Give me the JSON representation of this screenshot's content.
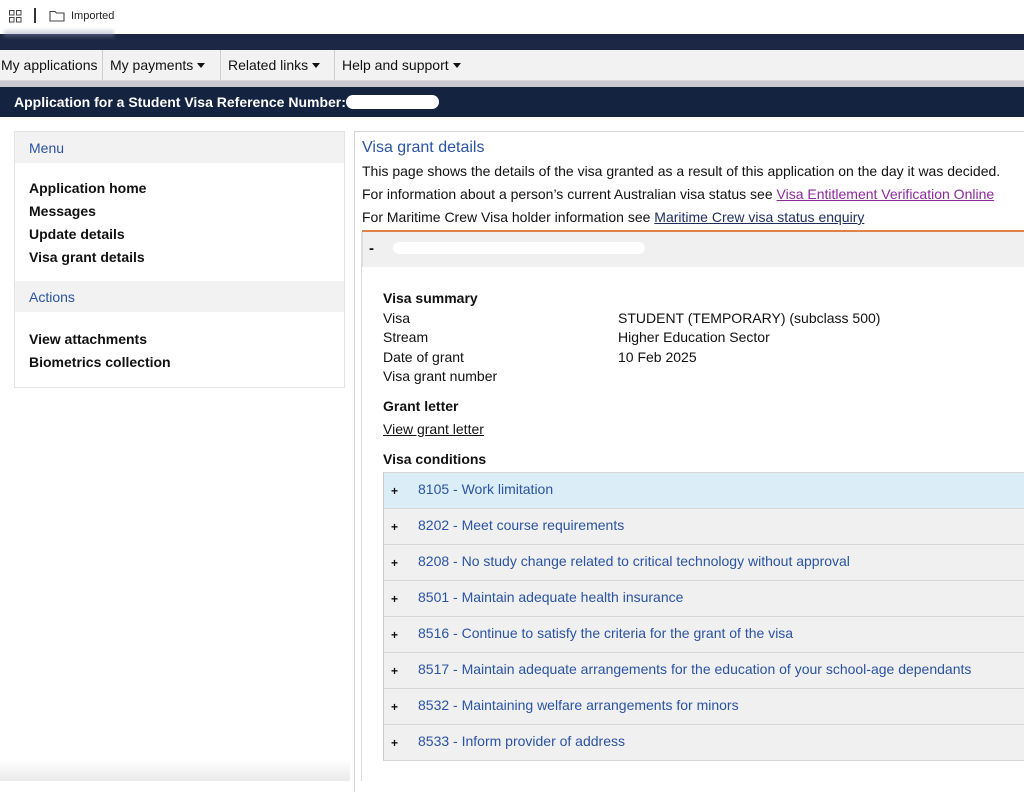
{
  "bookmarks": {
    "folder_label": "Imported"
  },
  "nav": {
    "items": [
      {
        "label": "My applications"
      },
      {
        "label": "My payments"
      },
      {
        "label": "Related links"
      },
      {
        "label": "Help and support"
      }
    ]
  },
  "title_bar": {
    "text": "Application for a Student Visa Reference Number:"
  },
  "sidebar": {
    "menu_heading": "Menu",
    "menu_items": [
      "Application home",
      "Messages",
      "Update details",
      "Visa grant details"
    ],
    "actions_heading": "Actions",
    "action_items": [
      "View attachments",
      "Biometrics collection"
    ]
  },
  "main": {
    "title": "Visa grant details",
    "intro": "This page shows the details of the visa granted as a result of this application on the day it was decided.",
    "info_prefix": "For information about a person’s current Australian visa status see ",
    "vevo_link": "Visa Entitlement Verification Online",
    "crew_prefix": "For Maritime Crew Visa holder information see ",
    "crew_link": "Maritime Crew visa status enquiry",
    "accordion_toggle": "-",
    "summary_heading": "Visa summary",
    "summary": [
      {
        "label": "Visa",
        "value": "STUDENT (TEMPORARY) (subclass 500)"
      },
      {
        "label": "Stream",
        "value": "Higher Education Sector"
      },
      {
        "label": "Date of grant",
        "value": "10 Feb 2025"
      },
      {
        "label": "Visa grant number",
        "value": ""
      }
    ],
    "grant_letter_heading": "Grant letter",
    "grant_letter_link": "View grant letter",
    "conditions_heading": "Visa conditions",
    "conditions": [
      "8105 - Work limitation",
      "8202 - Meet course requirements",
      "8208 - No study change related to critical technology without approval",
      "8501 - Maintain adequate health insurance",
      "8516 - Continue to satisfy the criteria for the grant of the visa",
      "8517 - Maintain adequate arrangements for the education of your school-age dependants",
      "8532 - Maintaining welfare arrangements for minors",
      "8533 - Inform provider of address"
    ],
    "expand_symbol": "+"
  }
}
